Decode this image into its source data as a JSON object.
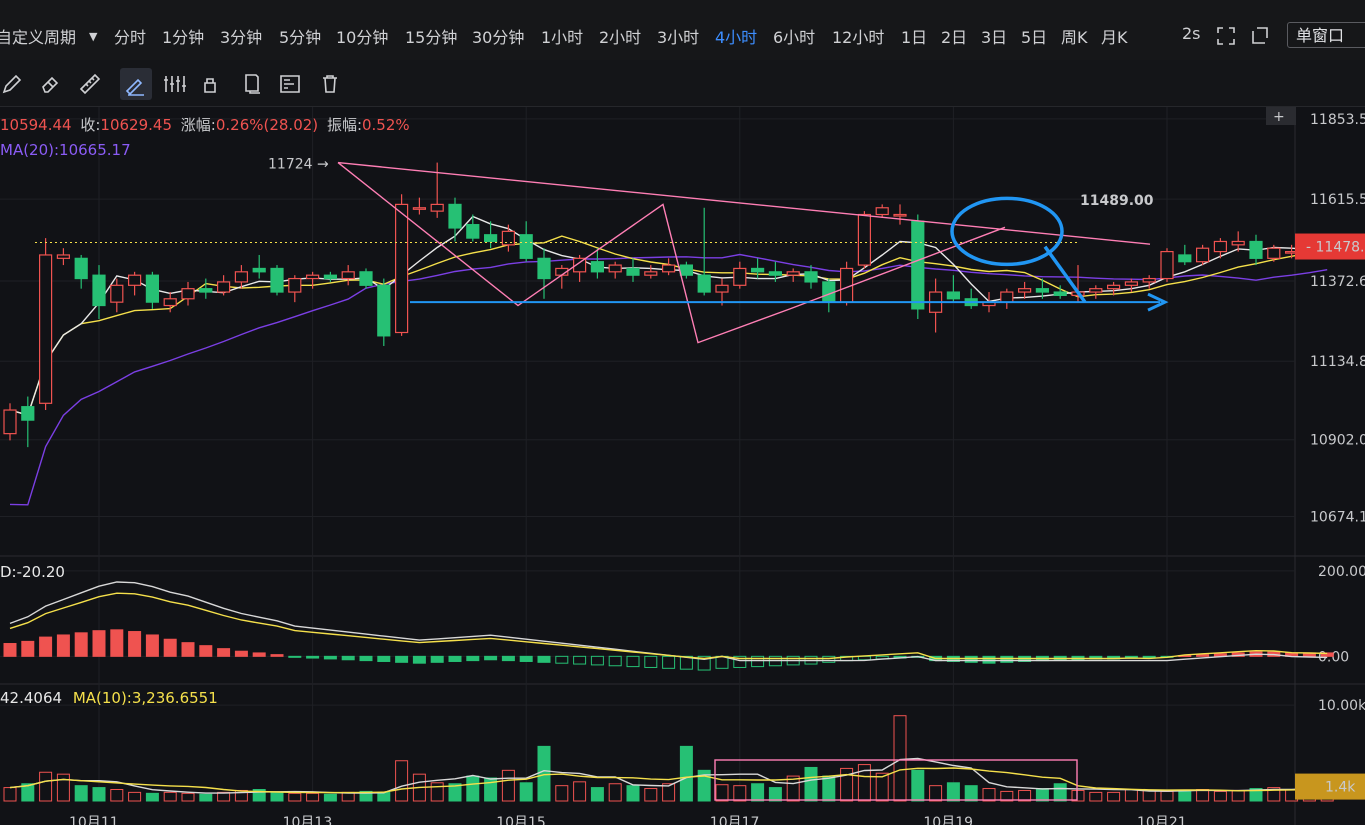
{
  "periods": [
    "自定义周期",
    "分时",
    "1分钟",
    "3分钟",
    "5分钟",
    "10分钟",
    "15分钟",
    "30分钟",
    "1小时",
    "2小时",
    "3小时",
    "4小时",
    "6小时",
    "12小时",
    "1日",
    "2日",
    "3日",
    "5日",
    "周K",
    "月K"
  ],
  "active_period": "4小时",
  "toolbar_right": {
    "refresh": "2s",
    "window_mode": "单窗口"
  },
  "tools": [
    "pencil-icon",
    "eraser-icon",
    "ruler-icon",
    "draw-line-icon",
    "candle-icon",
    "lock-icon",
    "copy-icon",
    "layer-icon",
    "trash-icon"
  ],
  "ohlc_text": {
    "open": "10594.44",
    "close_label": "收:",
    "close": "10629.45",
    "change_label": "涨幅:",
    "change": "0.26%(28.02)",
    "amp_label": "振幅:",
    "amp": "0.52%"
  },
  "ma_text": "MA(20):10665.17",
  "macd_text": "D:-20.20",
  "vol_text": {
    "a": "42.4064",
    "ma10": "MA(10):3,236.6551"
  },
  "colors": {
    "up": "#ef5350",
    "down": "#26c074",
    "ma_white": "#e8e8e8",
    "ma_yellow": "#f5e04b",
    "ma_purple": "#7b3fe4",
    "annotation": "#2196f3",
    "trendline": "#ff7fb5"
  },
  "chart_data": {
    "type": "candlestick",
    "price_axis": {
      "ticks": [
        "11853.5",
        "11615.5",
        "11372.6",
        "11134.8",
        "10902.0",
        "10674.1"
      ],
      "range": [
        10560,
        11880
      ]
    },
    "current_price_label": "11478.0",
    "high_marker": "11724",
    "annotation_price": "11489.00",
    "date_ticks": [
      "10月11",
      "10月13",
      "10月15",
      "10月17",
      "10月19",
      "10月21"
    ],
    "candles": [
      [
        10920,
        11010,
        10900,
        10990
      ],
      [
        11000,
        11030,
        10880,
        10960
      ],
      [
        11010,
        11500,
        10990,
        11450
      ],
      [
        11440,
        11470,
        11420,
        11450
      ],
      [
        11440,
        11450,
        11350,
        11380
      ],
      [
        11390,
        11420,
        11260,
        11300
      ],
      [
        11310,
        11380,
        11280,
        11360
      ],
      [
        11360,
        11400,
        11330,
        11390
      ],
      [
        11390,
        11400,
        11290,
        11310
      ],
      [
        11300,
        11340,
        11280,
        11320
      ],
      [
        11320,
        11370,
        11300,
        11350
      ],
      [
        11350,
        11380,
        11320,
        11340
      ],
      [
        11340,
        11390,
        11330,
        11370
      ],
      [
        11370,
        11420,
        11350,
        11400
      ],
      [
        11410,
        11450,
        11380,
        11400
      ],
      [
        11410,
        11420,
        11330,
        11340
      ],
      [
        11340,
        11390,
        11310,
        11380
      ],
      [
        11380,
        11400,
        11350,
        11390
      ],
      [
        11390,
        11400,
        11370,
        11380
      ],
      [
        11380,
        11420,
        11360,
        11400
      ],
      [
        11400,
        11410,
        11350,
        11360
      ],
      [
        11360,
        11380,
        11180,
        11210
      ],
      [
        11220,
        11630,
        11210,
        11600
      ],
      [
        11590,
        11620,
        11570,
        11590
      ],
      [
        11580,
        11724,
        11560,
        11600
      ],
      [
        11600,
        11620,
        11490,
        11530
      ],
      [
        11540,
        11570,
        11490,
        11500
      ],
      [
        11510,
        11550,
        11470,
        11490
      ],
      [
        11480,
        11540,
        11460,
        11520
      ],
      [
        11510,
        11550,
        11430,
        11440
      ],
      [
        11440,
        11470,
        11320,
        11380
      ],
      [
        11390,
        11420,
        11350,
        11410
      ],
      [
        11400,
        11450,
        11370,
        11440
      ],
      [
        11430,
        11470,
        11380,
        11400
      ],
      [
        11400,
        11430,
        11380,
        11420
      ],
      [
        11410,
        11440,
        11370,
        11390
      ],
      [
        11390,
        11420,
        11380,
        11400
      ],
      [
        11400,
        11440,
        11390,
        11420
      ],
      [
        11420,
        11430,
        11380,
        11390
      ],
      [
        11390,
        11590,
        11330,
        11340
      ],
      [
        11340,
        11380,
        11300,
        11360
      ],
      [
        11360,
        11430,
        11350,
        11410
      ],
      [
        11410,
        11440,
        11380,
        11400
      ],
      [
        11400,
        11430,
        11370,
        11390
      ],
      [
        11390,
        11410,
        11370,
        11400
      ],
      [
        11400,
        11420,
        11350,
        11370
      ],
      [
        11370,
        11380,
        11280,
        11310
      ],
      [
        11310,
        11430,
        11300,
        11410
      ],
      [
        11420,
        11580,
        11410,
        11570
      ],
      [
        11570,
        11600,
        11560,
        11590
      ],
      [
        11570,
        11600,
        11540,
        11570
      ],
      [
        11550,
        11570,
        11260,
        11290
      ],
      [
        11280,
        11380,
        11220,
        11340
      ],
      [
        11340,
        11390,
        11310,
        11320
      ],
      [
        11320,
        11350,
        11290,
        11300
      ],
      [
        11300,
        11340,
        11280,
        11310
      ],
      [
        11310,
        11350,
        11290,
        11340
      ],
      [
        11340,
        11370,
        11320,
        11350
      ],
      [
        11350,
        11380,
        11320,
        11340
      ],
      [
        11340,
        11360,
        11320,
        11330
      ],
      [
        11330,
        11420,
        11310,
        11340
      ],
      [
        11340,
        11360,
        11320,
        11350
      ],
      [
        11350,
        11370,
        11330,
        11360
      ],
      [
        11360,
        11380,
        11340,
        11370
      ],
      [
        11370,
        11390,
        11350,
        11380
      ],
      [
        11380,
        11470,
        11370,
        11460
      ],
      [
        11450,
        11480,
        11420,
        11430
      ],
      [
        11430,
        11480,
        11420,
        11470
      ],
      [
        11460,
        11500,
        11440,
        11490
      ],
      [
        11480,
        11520,
        11460,
        11490
      ],
      [
        11490,
        11510,
        11420,
        11440
      ],
      [
        11440,
        11480,
        11430,
        11470
      ],
      [
        11460,
        11480,
        11440,
        11460
      ],
      [
        11460,
        11480,
        11440,
        11470
      ],
      [
        11470,
        11480,
        11450,
        11478
      ]
    ],
    "macd_axis": {
      "ticks": [
        "200.00",
        "0.00"
      ],
      "range": [
        -60,
        230
      ]
    },
    "macd_hist": [
      30,
      35,
      45,
      50,
      55,
      60,
      62,
      58,
      50,
      40,
      32,
      25,
      18,
      12,
      8,
      4,
      -2,
      -4,
      -6,
      -8,
      -10,
      -12,
      -14,
      -16,
      -14,
      -12,
      -10,
      -8,
      -10,
      -12,
      -14,
      -16,
      -18,
      -20,
      -22,
      -24,
      -26,
      -28,
      -30,
      -32,
      -28,
      -26,
      -24,
      -22,
      -20,
      -18,
      -14,
      -10,
      -8,
      -6,
      -4,
      -2,
      -10,
      -12,
      -14,
      -16,
      -14,
      -12,
      -10,
      -8,
      -8,
      -6,
      -6,
      -4,
      -4,
      -2,
      2,
      4,
      6,
      8,
      10,
      10,
      8,
      8,
      8
    ],
    "volume_axis": {
      "ticks": [
        "10.00k"
      ],
      "range": [
        0,
        12000
      ]
    },
    "volume_current_label": "1.4k",
    "volume": [
      1400,
      1800,
      3000,
      2800,
      1600,
      1400,
      1200,
      900,
      800,
      900,
      800,
      700,
      900,
      1100,
      1200,
      900,
      800,
      800,
      700,
      900,
      1000,
      900,
      4200,
      2800,
      1900,
      1800,
      2600,
      2400,
      3200,
      1900,
      5700,
      1600,
      2000,
      1400,
      1800,
      1600,
      1300,
      1800,
      5700,
      3200,
      1700,
      1600,
      1800,
      1400,
      2600,
      3500,
      2600,
      3400,
      3800,
      2900,
      8900,
      3200,
      1600,
      1900,
      1600,
      1300,
      1000,
      1100,
      1300,
      1800,
      1100,
      900,
      900,
      1200,
      1100,
      1000,
      1100,
      1200,
      1000,
      1100,
      1300,
      1400,
      1200,
      1400,
      1400
    ]
  }
}
